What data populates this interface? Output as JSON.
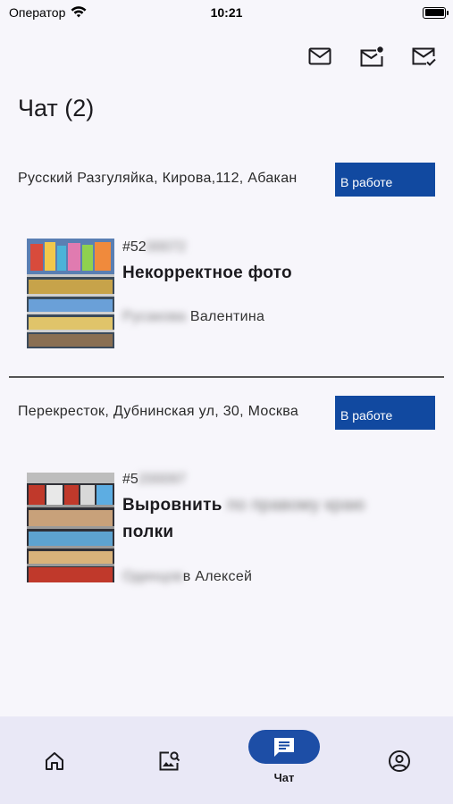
{
  "status_bar": {
    "carrier": "Оператор",
    "time": "10:21"
  },
  "header": {
    "title": "Чат (2)",
    "icons": [
      "mail-icon",
      "mail-unread-icon",
      "mail-check-icon"
    ]
  },
  "chats": [
    {
      "address": "Русский Разгуляйка, Кирова,112, Абакан",
      "status": "В работе",
      "number_visible": "#52",
      "number_hidden": "00072",
      "title_visible": "Некорректное фото",
      "title_hidden": "",
      "user_hidden": "Русакова",
      "user_visible": "Валентина"
    },
    {
      "address": "Перекресток, Дубнинская ул, 30, Москва",
      "status": "В работе",
      "number_visible": "#5",
      "number_hidden": "200097",
      "title_visible": "Выровнить",
      "title_hidden": "по правому краю",
      "title_line2": "полки",
      "user_hidden": "Одинцов",
      "user_visible": "в Алексей"
    }
  ],
  "bottom_nav": {
    "items": [
      {
        "icon": "home-icon",
        "label": ""
      },
      {
        "icon": "image-search-icon",
        "label": ""
      },
      {
        "icon": "chat-icon",
        "label": "Чат",
        "active": true
      },
      {
        "icon": "account-icon",
        "label": ""
      }
    ]
  },
  "colors": {
    "accent": "#1d4ea6",
    "badge": "#1149a0",
    "nav_bg": "#e9e8f6",
    "bg": "#f7f6fb"
  }
}
